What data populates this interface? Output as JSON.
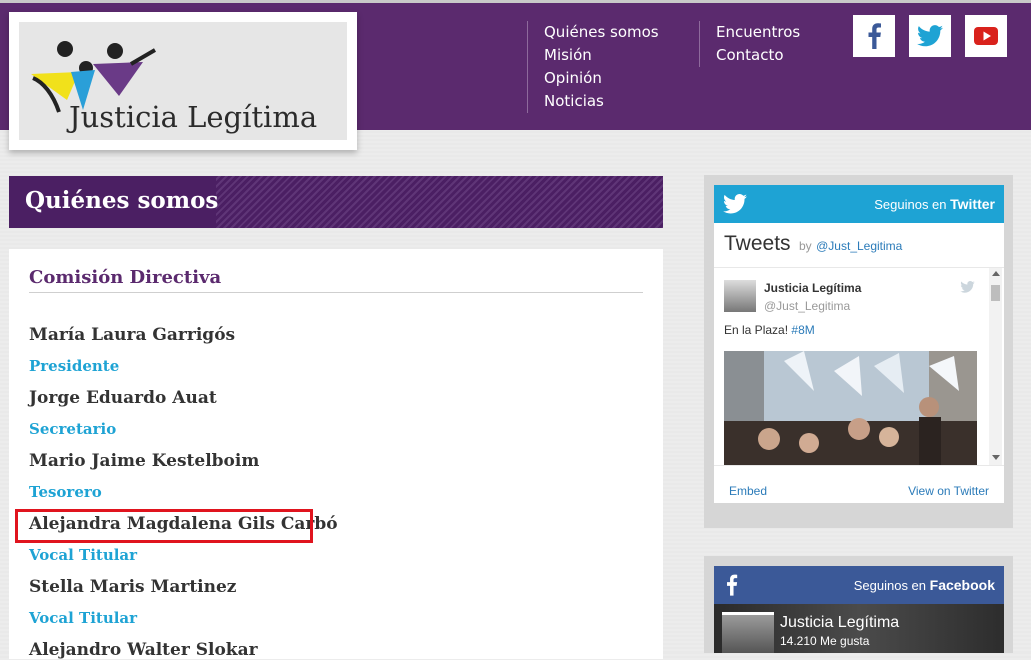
{
  "header": {
    "logo_text": "Justicia Legítima",
    "nav_col1": [
      "Quiénes somos",
      "Misión",
      "Opinión",
      "Noticias"
    ],
    "nav_col2": [
      "Encuentros",
      "Contacto"
    ],
    "social": [
      "facebook-icon",
      "twitter-icon",
      "youtube-icon"
    ]
  },
  "page": {
    "section_title": "Quiénes somos",
    "subtitle": "Comisión Directiva",
    "members": [
      {
        "name": "María Laura Garrigós",
        "role": "Presidente"
      },
      {
        "name": "Jorge Eduardo Auat",
        "role": "Secretario"
      },
      {
        "name": "Mario Jaime Kestelboim",
        "role": "Tesorero"
      },
      {
        "name": "Alejandra Magdalena Gils Carbó",
        "role": "Vocal Titular"
      },
      {
        "name": "Stella Maris Martinez",
        "role": "Vocal Titular"
      },
      {
        "name": "Alejandro Walter Slokar",
        "role": ""
      }
    ]
  },
  "twitter_widget": {
    "follow_prefix": "Seguinos en",
    "follow_brand": "Twitter",
    "title": "Tweets",
    "by": "by",
    "handle_link": "@Just_Legitima",
    "tweet_author": "Justicia Legítima",
    "tweet_handle": "@Just_Legitima",
    "tweet_text": "En la Plaza!",
    "tweet_hashtag": "#8M",
    "embed": "Embed",
    "view_on": "View on Twitter"
  },
  "facebook_widget": {
    "follow_prefix": "Seguinos en",
    "follow_brand": "Facebook",
    "page_name": "Justicia Legítima",
    "likes": "14.210 Me gusta"
  },
  "colors": {
    "header_purple": "#5b2a6e",
    "role_blue": "#1ea3d4",
    "twitter_blue": "#1ea3d4",
    "facebook_blue": "#3b5998",
    "highlight_red": "#e0141e"
  }
}
